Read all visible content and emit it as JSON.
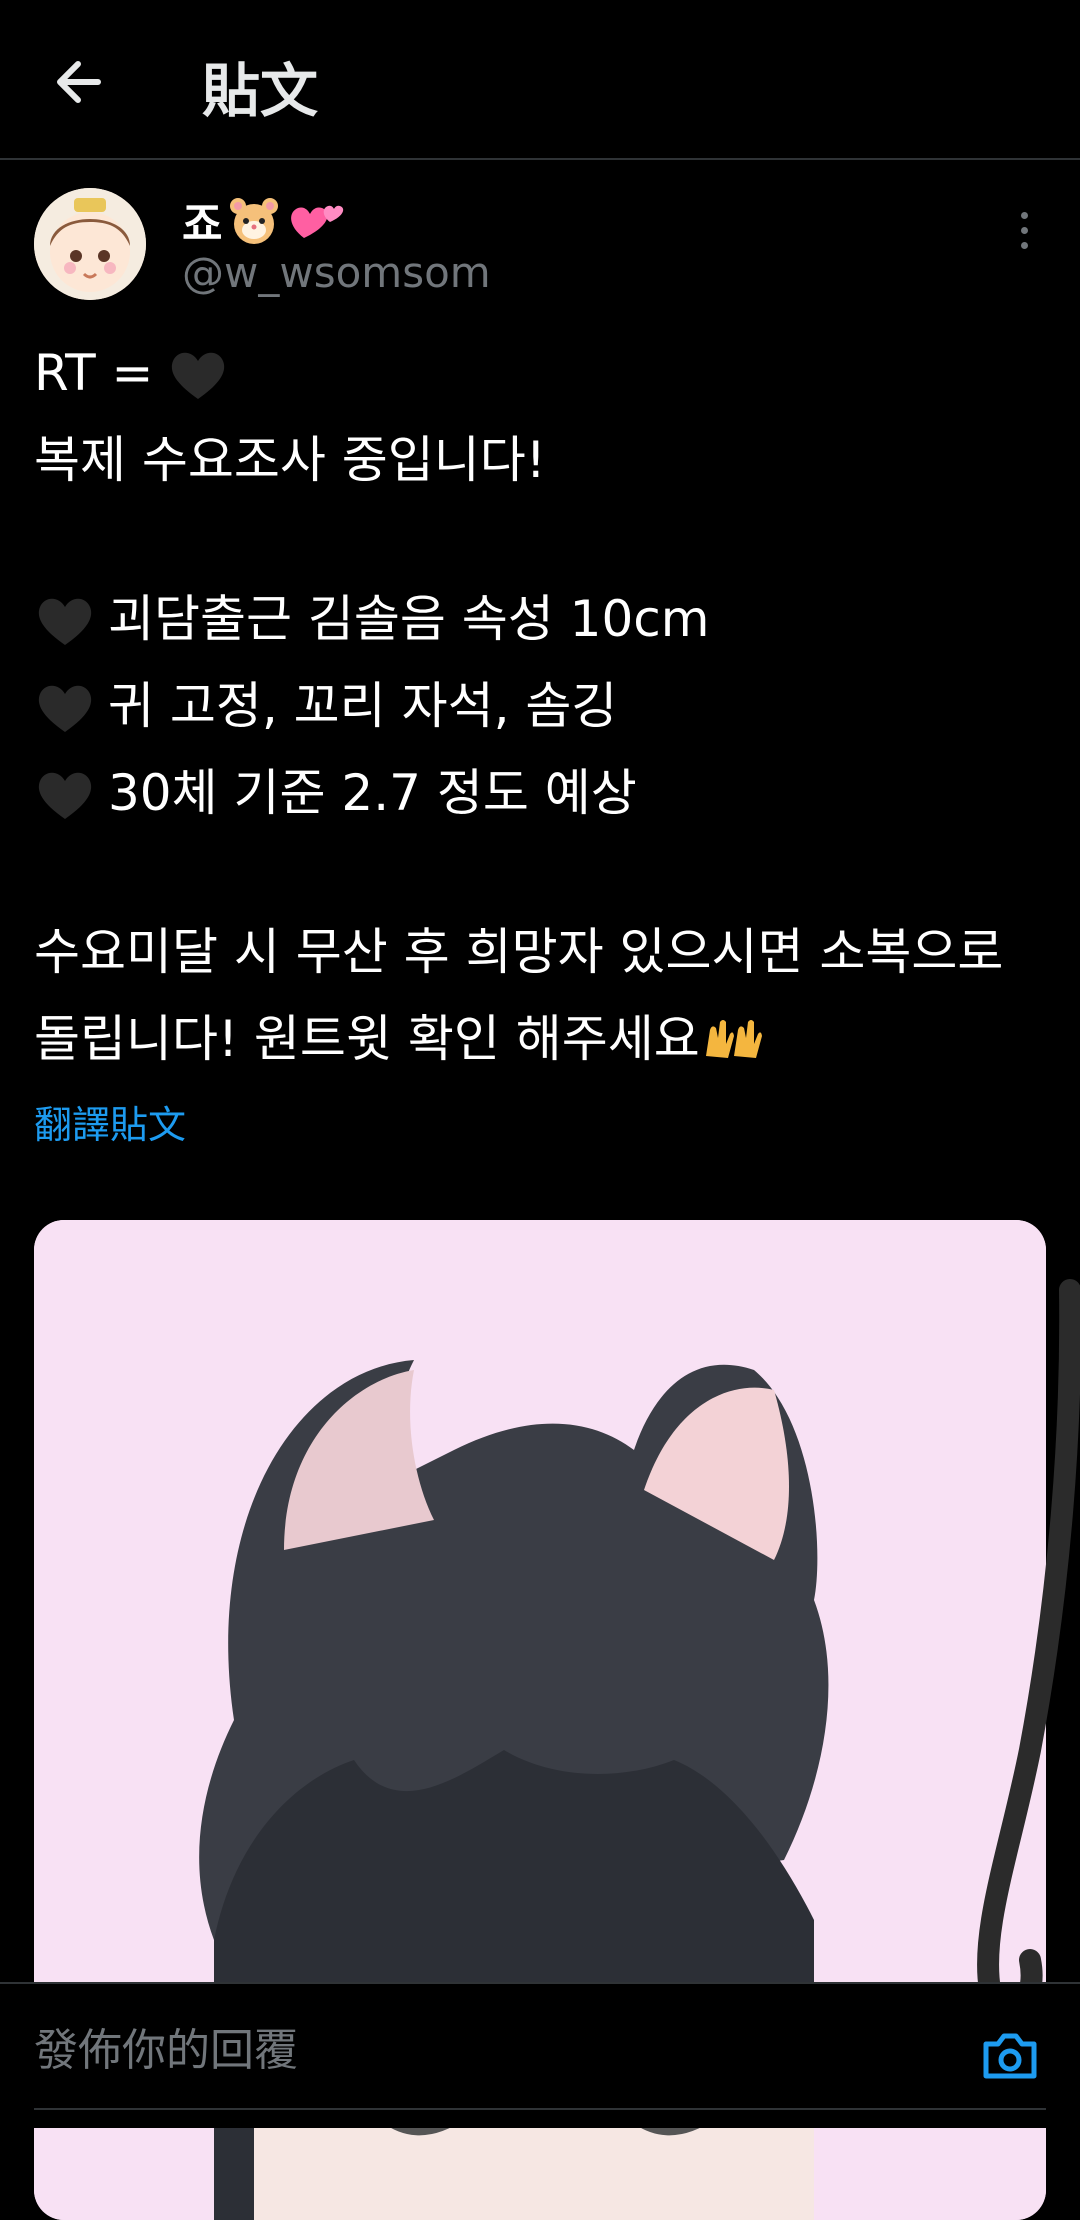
{
  "header": {
    "title": "貼文"
  },
  "post": {
    "author_name": "죠",
    "author_handle": "@w_wsomsom",
    "lines": [
      "RT =",
      "복제 수요조사 중입니다!",
      "괴담출근 김솔음 속성 10cm",
      "귀 고정, 꼬리 자석, 솜깅",
      "30체 기준 2.7 정도 예상",
      "수요미달 시 무산 후 희망자 있으시면 소복으로",
      "돌립니다! 원트윗 확인 해주세요"
    ],
    "translate_label": "翻譯貼文"
  },
  "reply": {
    "placeholder": "發佈你的回覆"
  },
  "icons": {
    "back": "arrow-left-icon",
    "more": "more-vertical-icon",
    "heart": "black-heart-emoji",
    "camera": "camera-icon"
  },
  "colors": {
    "accent": "#1d9bf0",
    "muted": "#71767b",
    "media_bg": "#f8e1f4"
  }
}
